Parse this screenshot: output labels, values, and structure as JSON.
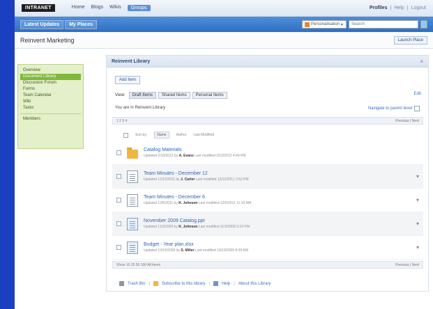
{
  "topbar": {
    "logo": "INTRANET",
    "nav": [
      "Home",
      "Blogs",
      "Wikis",
      "Groups"
    ],
    "active_nav_index": 3,
    "links": [
      "Profiles",
      "Help",
      "Logout"
    ]
  },
  "bluebar": {
    "breadcrumbs": [
      "Latest Updates",
      "My Places"
    ],
    "search_scope": "Personalisation",
    "search_placeholder": "Search"
  },
  "page": {
    "title": "Reinvent Marketing",
    "launch_button": "Launch Place"
  },
  "sidebar": {
    "items": [
      "Overview",
      "Document Library",
      "Discussion Forum",
      "Forms",
      "Team Calendar",
      "Wiki",
      "Tasks"
    ],
    "active_index": 1,
    "extra": "Members"
  },
  "panel": {
    "title": "Reinvent Library",
    "close": "×",
    "add_button": "Add Item",
    "view_label": "View:",
    "views": [
      "Draft Items",
      "Shared Items",
      "Personal Items"
    ],
    "edit_link": "Edit",
    "info": "You are in Reinvent Library",
    "navigate_up": "Navigate to parent level",
    "pager_top_left": "1 2 3 4",
    "pager_top_right": "Previous | Next",
    "columns": [
      "Sort by:",
      "Name",
      "Author",
      "Last Modified"
    ],
    "rows": [
      {
        "icon": "folder",
        "title": "Catalog Materials",
        "meta_prefix": "Updated 2/10/2012 by",
        "author": "A. Evans",
        "meta_suffix": " Last modified 2/10/2012 4:49 PM"
      },
      {
        "icon": "doc",
        "title": "Team Minutes - December 12",
        "meta_prefix": "Updated 12/12/2011 by",
        "author": "J. Carter",
        "meta_suffix": " Last modified 12/12/2011 3:52 PM"
      },
      {
        "icon": "doc",
        "title": "Team Minutes - December 6",
        "meta_prefix": "Updated 12/6/2011 by",
        "author": "K. Johnson",
        "meta_suffix": " Last modified 12/6/2011 11:15 AM"
      },
      {
        "icon": "docblue",
        "title": "November 2009 Catalog.ppt",
        "meta_prefix": "Updated 11/3/2009 by",
        "author": "K. Johnson",
        "meta_suffix": " Last modified 11/3/2009 2:10 PM"
      },
      {
        "icon": "docblue",
        "title": "Budget - Year plan.xlsx",
        "meta_prefix": "Updated 10/19/2009 by",
        "author": "S. Miller",
        "meta_suffix": " Last modified 10/19/2009 9:30 AM"
      }
    ],
    "pager_bottom_left": "Show 10 25 50 100 All items",
    "pager_bottom_right": "Previous | Next",
    "footer_links": [
      "Trash Bin",
      "Subscribe to this library",
      "Help",
      "About this Library"
    ]
  }
}
